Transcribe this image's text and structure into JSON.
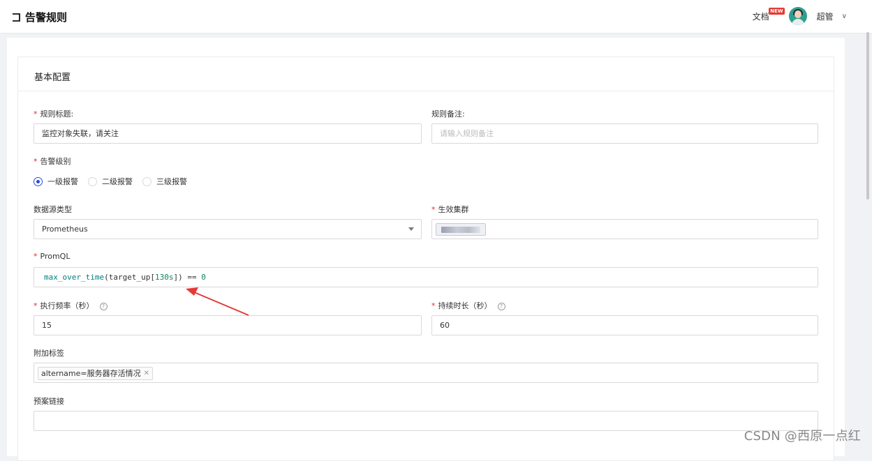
{
  "header": {
    "title": "告警规则",
    "docs_label": "文档",
    "docs_badge": "NEW",
    "user_name": "超管"
  },
  "section": {
    "title": "基本配置"
  },
  "form": {
    "rule_title": {
      "label": "规则标题:",
      "value": "监控对象失联，请关注"
    },
    "rule_note": {
      "label": "规则备注:",
      "placeholder": "请输入规则备注"
    },
    "severity": {
      "label": "告警级别",
      "options": [
        "一级报警",
        "二级报警",
        "三级报警"
      ],
      "selected": "一级报警"
    },
    "datasource_type": {
      "label": "数据源类型",
      "value": "Prometheus"
    },
    "cluster": {
      "label": "生效集群"
    },
    "promql": {
      "label": "PromQL",
      "tokens": {
        "fn": "max_over_time",
        "open": "(target_up[",
        "duration": "130s",
        "close": "]) == ",
        "zero": "0"
      }
    },
    "exec_frequency": {
      "label": "执行频率（秒）",
      "value": "15"
    },
    "duration": {
      "label": "持续时长（秒）",
      "value": "60"
    },
    "extra_labels": {
      "label": "附加标签",
      "tag": "altername=服务器存活情况"
    },
    "runbook": {
      "label": "预案链接",
      "value": ""
    }
  },
  "watermark": "CSDN @西原一点红",
  "colors": {
    "accent": "#2c4bd6",
    "required": "#f5222d",
    "annotation_arrow": "#e53935"
  }
}
